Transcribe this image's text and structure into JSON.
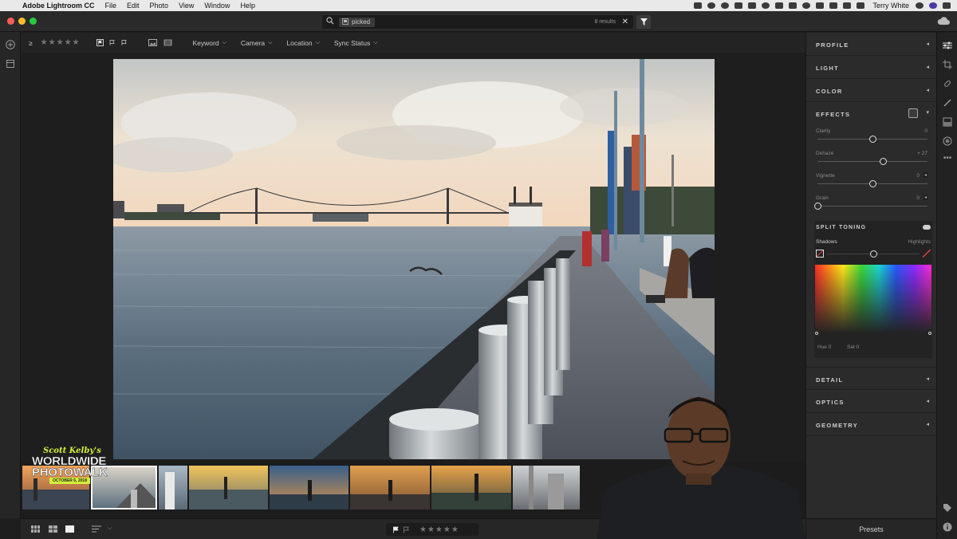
{
  "menubar": {
    "app_name": "Adobe Lightroom CC",
    "menus": [
      "File",
      "Edit",
      "Photo",
      "View",
      "Window",
      "Help"
    ],
    "user": "Terry White"
  },
  "search": {
    "query_chip": "picked",
    "results": "8 results",
    "clear_glyph": "✕"
  },
  "toolbar": {
    "sort_glyph": "≥",
    "dropdowns": [
      "Keyword",
      "Camera",
      "Location",
      "Sync Status"
    ]
  },
  "right_panel": {
    "sections_top": [
      "PROFILE",
      "LIGHT",
      "COLOR",
      "EFFECTS"
    ],
    "effects_sliders": [
      {
        "label": "Clarity",
        "value": "0",
        "level": 0.5
      },
      {
        "label": "Dehaze",
        "value": "+ 27",
        "level": 0.6
      },
      {
        "label": "Vignette",
        "value": "0",
        "level": 0.5
      },
      {
        "label": "Grain",
        "value": "0",
        "level": 0.0
      }
    ],
    "split_toning": {
      "title": "SPLIT TONING",
      "shadows_label": "Shadows",
      "highlights_label": "Highlights",
      "hue_label": "Hue 0",
      "sat_label": "Sat 0",
      "balance_level": 0.5
    },
    "sections_bottom": [
      "DETAIL",
      "OPTICS",
      "GEOMETRY"
    ],
    "presets_label": "Presets"
  },
  "logo": {
    "line1": "Scott Kelby's",
    "line2": "WORLDWIDE",
    "line3": "PHOTOWALK",
    "line4": "OCTOBER 6, 2018"
  },
  "colors": {
    "close": "#ff5f57",
    "minimize": "#febc2e",
    "maximize": "#28c840",
    "accent_lime": "#d4f03a"
  }
}
